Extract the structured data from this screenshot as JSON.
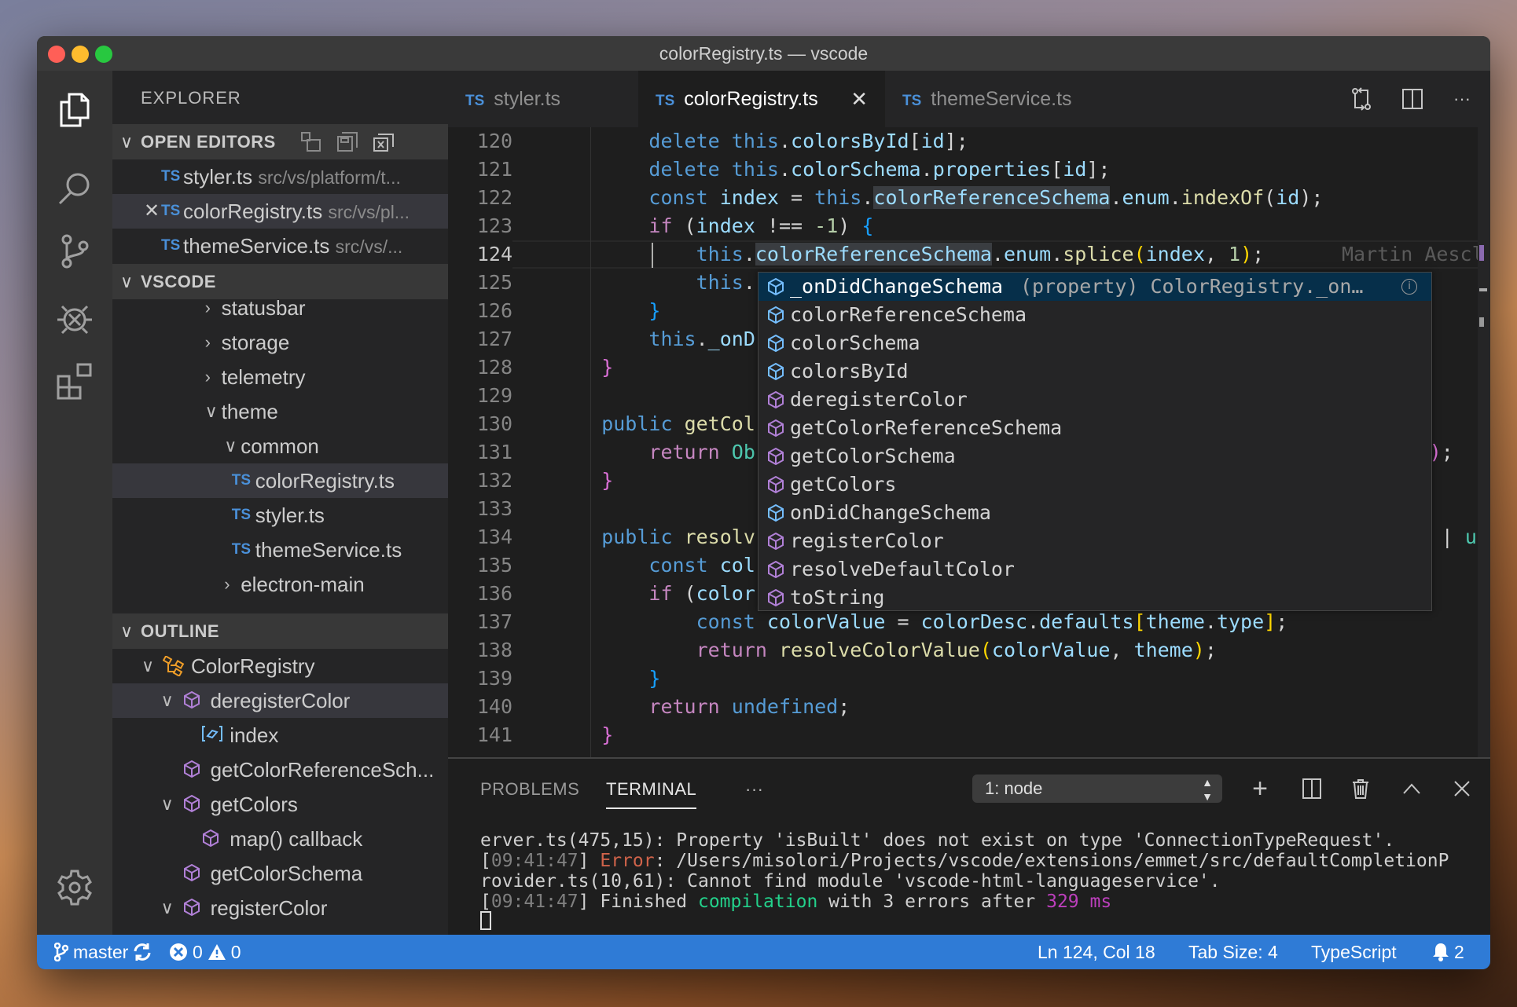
{
  "window": {
    "title": "colorRegistry.ts — vscode"
  },
  "colors": {
    "accent": "#2f7bd6",
    "close": "#ff5f57",
    "minimize": "#febc2e",
    "maximize": "#28c840",
    "method": "#b180d7",
    "property": "#75beff",
    "class": "#ee9d28"
  },
  "activity_bar": [
    "files-icon",
    "search-icon",
    "source-control-icon",
    "debug-icon",
    "extensions-icon",
    "settings-gear-icon"
  ],
  "sidebar": {
    "title": "EXPLORER",
    "open_editors": {
      "label": "OPEN EDITORS",
      "actions": [
        "new-untitled-file-icon",
        "save-all-icon",
        "close-all-icon"
      ],
      "items": [
        {
          "badge": "TS",
          "name": "styler.ts",
          "path": "src/vs/platform/t...",
          "active": false
        },
        {
          "badge": "TS",
          "name": "colorRegistry.ts",
          "path": "src/vs/pl...",
          "active": true
        },
        {
          "badge": "TS",
          "name": "themeService.ts",
          "path": "src/vs/...",
          "active": false
        }
      ]
    },
    "folder": {
      "label": "VSCODE",
      "items": [
        {
          "label": "statusbar",
          "depth": 1,
          "type": "folder",
          "expanded": false
        },
        {
          "label": "storage",
          "depth": 1,
          "type": "folder",
          "expanded": false
        },
        {
          "label": "telemetry",
          "depth": 1,
          "type": "folder",
          "expanded": false
        },
        {
          "label": "theme",
          "depth": 1,
          "type": "folder",
          "expanded": true
        },
        {
          "label": "common",
          "depth": 2,
          "type": "folder",
          "expanded": true
        },
        {
          "label": "colorRegistry.ts",
          "depth": 3,
          "type": "file",
          "badge": "TS",
          "selected": true
        },
        {
          "label": "styler.ts",
          "depth": 3,
          "type": "file",
          "badge": "TS"
        },
        {
          "label": "themeService.ts",
          "depth": 3,
          "type": "file",
          "badge": "TS"
        },
        {
          "label": "electron-main",
          "depth": 2,
          "type": "folder",
          "expanded": false
        }
      ]
    },
    "outline": {
      "label": "OUTLINE",
      "items": [
        {
          "label": "ColorRegistry",
          "depth": 0,
          "kind": "class",
          "expanded": true
        },
        {
          "label": "deregisterColor",
          "depth": 1,
          "kind": "method",
          "expanded": true,
          "selected": true
        },
        {
          "label": "index",
          "depth": 2,
          "kind": "variable"
        },
        {
          "label": "getColorReferenceSch...",
          "depth": 1,
          "kind": "method"
        },
        {
          "label": "getColors",
          "depth": 1,
          "kind": "method",
          "expanded": true
        },
        {
          "label": "map() callback",
          "depth": 2,
          "kind": "method"
        },
        {
          "label": "getColorSchema",
          "depth": 1,
          "kind": "method"
        },
        {
          "label": "registerColor",
          "depth": 1,
          "kind": "method",
          "expanded": true
        }
      ]
    }
  },
  "tabs": [
    {
      "badge": "TS",
      "label": "styler.ts",
      "active": false
    },
    {
      "badge": "TS",
      "label": "colorRegistry.ts",
      "active": true
    },
    {
      "badge": "TS",
      "label": "themeService.ts",
      "active": false
    }
  ],
  "editor_actions": [
    "open-changes-icon",
    "split-editor-icon",
    "more-actions-icon"
  ],
  "editor": {
    "current_line": 124,
    "blame": "Martin Aescl",
    "lines": [
      {
        "n": 120,
        "indent": 2,
        "tokens": [
          [
            "delete",
            "k"
          ],
          [
            " ",
            "p"
          ],
          [
            "this",
            "k"
          ],
          [
            ".",
            "p"
          ],
          [
            "colorsById",
            "v"
          ],
          [
            "[",
            "p"
          ],
          [
            "id",
            "v"
          ],
          [
            "];",
            "p"
          ]
        ]
      },
      {
        "n": 121,
        "indent": 2,
        "tokens": [
          [
            "delete",
            "k"
          ],
          [
            " ",
            "p"
          ],
          [
            "this",
            "k"
          ],
          [
            ".",
            "p"
          ],
          [
            "colorSchema",
            "v"
          ],
          [
            ".",
            "p"
          ],
          [
            "properties",
            "v"
          ],
          [
            "[",
            "p"
          ],
          [
            "id",
            "v"
          ],
          [
            "];",
            "p"
          ]
        ]
      },
      {
        "n": 122,
        "indent": 2,
        "tokens": [
          [
            "const",
            "k"
          ],
          [
            " ",
            "p"
          ],
          [
            "index",
            "v"
          ],
          [
            " = ",
            "p"
          ],
          [
            "this",
            "k"
          ],
          [
            ".",
            "p"
          ],
          [
            "colorReferenceSchema",
            "v",
            "hl"
          ],
          [
            ".",
            "p"
          ],
          [
            "enum",
            "v"
          ],
          [
            ".",
            "p"
          ],
          [
            "indexOf",
            "f"
          ],
          [
            "(",
            "p"
          ],
          [
            "id",
            "v"
          ],
          [
            ");",
            "p"
          ]
        ]
      },
      {
        "n": 123,
        "indent": 2,
        "tokens": [
          [
            "if",
            "c"
          ],
          [
            " (",
            "p"
          ],
          [
            "index",
            "v"
          ],
          [
            " !== ",
            "p"
          ],
          [
            "-1",
            "n"
          ],
          [
            ") ",
            "p"
          ],
          [
            "{",
            "b3"
          ]
        ]
      },
      {
        "n": 124,
        "indent": 3,
        "tokens": [
          [
            "this",
            "k"
          ],
          [
            ".",
            "p"
          ],
          [
            "colorReferenceSchema",
            "v",
            "hl"
          ],
          [
            ".",
            "p"
          ],
          [
            "enum",
            "v"
          ],
          [
            ".",
            "p"
          ],
          [
            "splice",
            "f"
          ],
          [
            "(",
            "b1"
          ],
          [
            "index",
            "v"
          ],
          [
            ", ",
            "p"
          ],
          [
            "1",
            "n"
          ],
          [
            ")",
            "b1"
          ],
          [
            ";",
            "p"
          ]
        ]
      },
      {
        "n": 125,
        "indent": 3,
        "tokens": [
          [
            "this",
            "k"
          ],
          [
            ".",
            "p"
          ]
        ]
      },
      {
        "n": 126,
        "indent": 2,
        "tokens": [
          [
            "}",
            "b3"
          ]
        ]
      },
      {
        "n": 127,
        "indent": 2,
        "tokens": [
          [
            "this",
            "k"
          ],
          [
            ".",
            "p"
          ],
          [
            "_onD",
            "v"
          ]
        ]
      },
      {
        "n": 128,
        "indent": 1,
        "tokens": [
          [
            "}",
            "b2"
          ]
        ]
      },
      {
        "n": 129,
        "indent": 0,
        "tokens": []
      },
      {
        "n": 130,
        "indent": 1,
        "tokens": [
          [
            "public",
            "k"
          ],
          [
            " ",
            "p"
          ],
          [
            "getCol",
            "f"
          ]
        ]
      },
      {
        "n": 131,
        "indent": 2,
        "tokens": [
          [
            "return",
            "c"
          ],
          [
            " ",
            "p"
          ],
          [
            "Ob",
            "t"
          ]
        ],
        "tail": {
          "col": 74,
          "tokens": [
            [
              ")",
              "b2"
            ],
            [
              ";",
              "p"
            ]
          ]
        }
      },
      {
        "n": 132,
        "indent": 1,
        "tokens": [
          [
            "}",
            "b2"
          ]
        ]
      },
      {
        "n": 133,
        "indent": 0,
        "tokens": []
      },
      {
        "n": 134,
        "indent": 1,
        "tokens": [
          [
            "public",
            "k"
          ],
          [
            " ",
            "p"
          ],
          [
            "resolv",
            "f"
          ]
        ],
        "tail": {
          "col": 75,
          "tokens": [
            [
              "| ",
              "p"
            ],
            [
              "un",
              "t"
            ]
          ]
        }
      },
      {
        "n": 135,
        "indent": 2,
        "tokens": [
          [
            "const",
            "k"
          ],
          [
            " ",
            "p"
          ],
          [
            "col",
            "v"
          ]
        ]
      },
      {
        "n": 136,
        "indent": 2,
        "tokens": [
          [
            "if",
            "c"
          ],
          [
            " (",
            "p"
          ],
          [
            "color",
            "v"
          ]
        ]
      },
      {
        "n": 137,
        "indent": 3,
        "tokens": [
          [
            "const",
            "k"
          ],
          [
            " ",
            "p"
          ],
          [
            "colorValue",
            "v"
          ],
          [
            " = ",
            "p"
          ],
          [
            "colorDesc",
            "v"
          ],
          [
            ".",
            "p"
          ],
          [
            "defaults",
            "v"
          ],
          [
            "[",
            "b1"
          ],
          [
            "theme",
            "v"
          ],
          [
            ".",
            "p"
          ],
          [
            "type",
            "v"
          ],
          [
            "]",
            "b1"
          ],
          [
            ";",
            "p"
          ]
        ]
      },
      {
        "n": 138,
        "indent": 3,
        "tokens": [
          [
            "return",
            "c"
          ],
          [
            " ",
            "p"
          ],
          [
            "resolveColorValue",
            "f"
          ],
          [
            "(",
            "b1"
          ],
          [
            "colorValue",
            "v"
          ],
          [
            ", ",
            "p"
          ],
          [
            "theme",
            "v"
          ],
          [
            ")",
            "b1"
          ],
          [
            ";",
            "p"
          ]
        ]
      },
      {
        "n": 139,
        "indent": 2,
        "tokens": [
          [
            "}",
            "b3"
          ]
        ]
      },
      {
        "n": 140,
        "indent": 2,
        "tokens": [
          [
            "return",
            "c"
          ],
          [
            " ",
            "p"
          ],
          [
            "undefined",
            "k"
          ],
          [
            ";",
            "p"
          ]
        ]
      },
      {
        "n": 141,
        "indent": 1,
        "tokens": [
          [
            "}",
            "b2"
          ]
        ]
      }
    ]
  },
  "suggest": [
    {
      "label": "_onDidChangeSchema",
      "kind": "property",
      "detail": "(property) ColorRegistry._on…",
      "selected": true
    },
    {
      "label": "colorReferenceSchema",
      "kind": "property"
    },
    {
      "label": "colorSchema",
      "kind": "property"
    },
    {
      "label": "colorsById",
      "kind": "property"
    },
    {
      "label": "deregisterColor",
      "kind": "method"
    },
    {
      "label": "getColorReferenceSchema",
      "kind": "method"
    },
    {
      "label": "getColorSchema",
      "kind": "method"
    },
    {
      "label": "getColors",
      "kind": "method"
    },
    {
      "label": "onDidChangeSchema",
      "kind": "property"
    },
    {
      "label": "registerColor",
      "kind": "method"
    },
    {
      "label": "resolveDefaultColor",
      "kind": "method"
    },
    {
      "label": "toString",
      "kind": "method"
    }
  ],
  "panel": {
    "tabs": [
      {
        "label": "PROBLEMS",
        "active": false
      },
      {
        "label": "TERMINAL",
        "active": true
      }
    ],
    "more": "···",
    "terminal_select": "1: node",
    "actions": [
      "new-terminal-icon",
      "split-terminal-icon",
      "kill-terminal-icon",
      "maximize-panel-icon",
      "close-panel-icon"
    ],
    "lines": [
      [
        [
          "erver.ts(475,15): Property 'isBuilt' does not exist on type 'ConnectionTypeRequest'.",
          ""
        ]
      ],
      [
        [
          "[",
          ""
        ],
        [
          "09:41:47",
          "g"
        ],
        [
          "] ",
          ""
        ],
        [
          "Error",
          "r"
        ],
        [
          ": /Users/misolori/Projects/vscode/extensions/emmet/src/defaultCompletionP",
          ""
        ]
      ],
      [
        [
          "rovider.ts(10,61): Cannot find module 'vscode-html-languageservice'.",
          ""
        ]
      ],
      [
        [
          "[",
          ""
        ],
        [
          "09:41:47",
          "g"
        ],
        [
          "] Finished ",
          ""
        ],
        [
          "compilation",
          "gr"
        ],
        [
          " with 3 errors after ",
          ""
        ],
        [
          "329 ms",
          "m"
        ]
      ]
    ]
  },
  "status": {
    "branch": "master",
    "errors": "0",
    "warnings": "0",
    "position": "Ln 124, Col 18",
    "tab_size": "Tab Size: 4",
    "language": "TypeScript",
    "notifications": "2"
  }
}
